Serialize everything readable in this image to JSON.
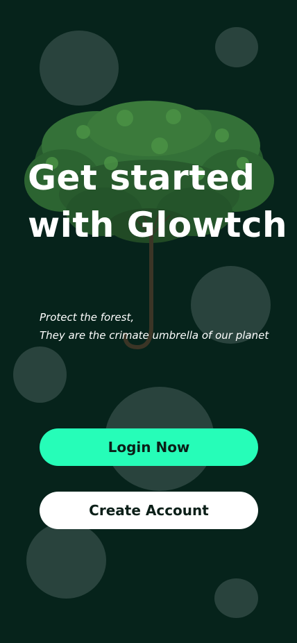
{
  "hero": {
    "title_line1": "Get started",
    "title_line2": "with Glowtch",
    "subtitle_line1": "Protect the forest,",
    "subtitle_line2": "They are the crimate umbrella of our planet",
    "illustration": "tree-umbrella-image"
  },
  "actions": {
    "login_label": "Login Now",
    "create_label": "Create Account"
  },
  "colors": {
    "background": "#06231b",
    "accent": "#26fdb8",
    "secondary_button": "#ffffff",
    "button_text": "#0b1f18",
    "bubble": "rgba(110,130,125,0.35)"
  }
}
